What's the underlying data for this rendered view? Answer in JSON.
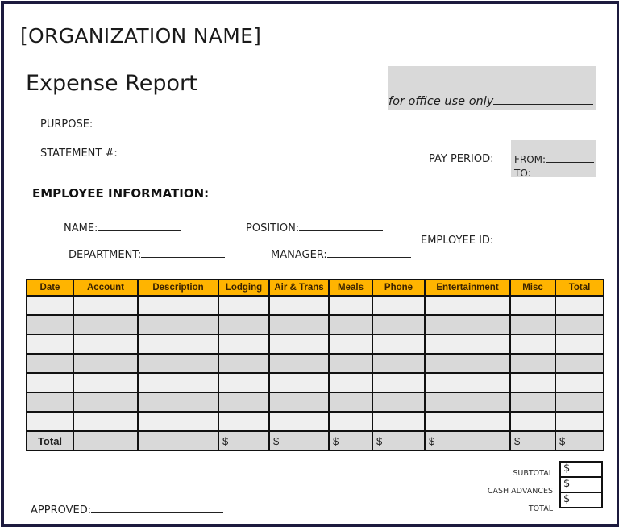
{
  "header": {
    "organization": "[ORGANIZATION NAME]",
    "title": "Expense Report",
    "office_use": "for office use only"
  },
  "fields": {
    "purpose": "PURPOSE:",
    "statement": "STATEMENT #:",
    "pay_period": "PAY PERIOD:",
    "from": "FROM:",
    "to": "TO:"
  },
  "employee": {
    "section_title": "EMPLOYEE INFORMATION:",
    "name": "NAME:",
    "position": "POSITION:",
    "employee_id": "EMPLOYEE ID:",
    "department": "DEPARTMENT:",
    "manager": "MANAGER:"
  },
  "table": {
    "columns": [
      "Date",
      "Account",
      "Description",
      "Lodging",
      "Air & Trans",
      "Meals",
      "Phone",
      "Entertainment",
      "Misc",
      "Total"
    ],
    "rows": [
      [
        "",
        "",
        "",
        "",
        "",
        "",
        "",
        "",
        "",
        ""
      ],
      [
        "",
        "",
        "",
        "",
        "",
        "",
        "",
        "",
        "",
        ""
      ],
      [
        "",
        "",
        "",
        "",
        "",
        "",
        "",
        "",
        "",
        ""
      ],
      [
        "",
        "",
        "",
        "",
        "",
        "",
        "",
        "",
        "",
        ""
      ],
      [
        "",
        "",
        "",
        "",
        "",
        "",
        "",
        "",
        "",
        ""
      ],
      [
        "",
        "",
        "",
        "",
        "",
        "",
        "",
        "",
        "",
        ""
      ],
      [
        "",
        "",
        "",
        "",
        "",
        "",
        "",
        "",
        "",
        ""
      ]
    ],
    "total_row": [
      "Total",
      "",
      "",
      "$",
      "$",
      "$",
      "$",
      "$",
      "$",
      "$"
    ]
  },
  "summary": {
    "subtotal_label": "SUBTOTAL",
    "subtotal_value": "$",
    "cash_advances_label": "CASH ADVANCES",
    "cash_advances_value": "$",
    "total_label": "TOTAL",
    "total_value": "$"
  },
  "footer": {
    "approved": "APPROVED:"
  },
  "colors": {
    "header_fill": "#ffb400",
    "row_light": "#efefef",
    "row_dark": "#d9d9d9",
    "frame": "#1c1a3e"
  }
}
